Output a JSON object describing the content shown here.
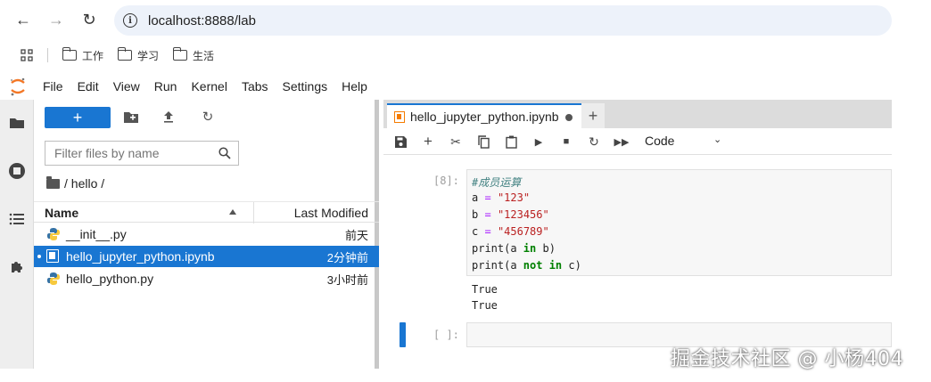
{
  "browser": {
    "url": "localhost:8888/lab"
  },
  "bookmarks": [
    {
      "label": "工作"
    },
    {
      "label": "学习"
    },
    {
      "label": "生活"
    }
  ],
  "menu": [
    "File",
    "Edit",
    "View",
    "Run",
    "Kernel",
    "Tabs",
    "Settings",
    "Help"
  ],
  "filebrowser": {
    "new_label": "+",
    "filter_placeholder": "Filter files by name",
    "breadcrumb": "/ hello /",
    "col_name": "Name",
    "col_modified": "Last Modified",
    "files": [
      {
        "name": "__init__.py",
        "modified": "前天"
      },
      {
        "name": "hello_jupyter_python.ipynb",
        "modified": "2分钟前"
      },
      {
        "name": "hello_python.py",
        "modified": "3小时前"
      }
    ]
  },
  "notebook": {
    "tab_title": "hello_jupyter_python.ipynb",
    "cell_type": "Code",
    "cell1_prompt": "[8]:",
    "code": {
      "comment": "#成员运算",
      "a_var": "a",
      "a_val": "\"123\"",
      "b_var": "b",
      "b_val": "\"123456\"",
      "c_var": "c",
      "c_val": "\"456789\"",
      "eq": "=",
      "print1_pre": "print(a ",
      "print1_kw": "in",
      "print1_post": " b)",
      "print2_pre": "print(a ",
      "print2_kw": "not in",
      "print2_post": " c)"
    },
    "outputs": [
      "True",
      "True"
    ],
    "cell2_prompt": "[ ]:"
  },
  "watermark": "掘金技术社区 @ 小杨404",
  "colors": {
    "accent": "#1976d2",
    "notebook_icon": "#f57c00"
  }
}
